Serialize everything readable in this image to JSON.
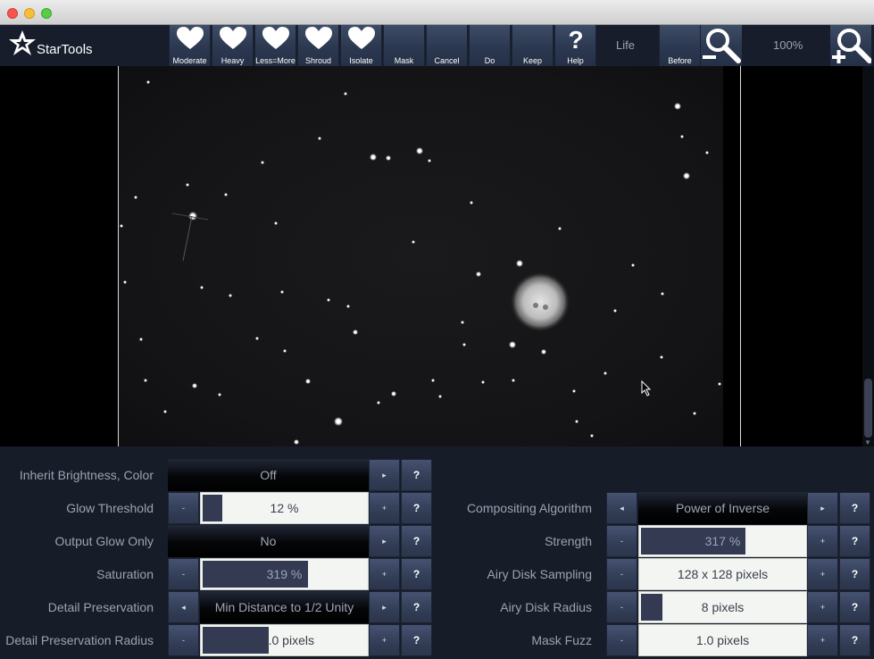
{
  "app": {
    "name": "StarTools"
  },
  "toolbar": {
    "buttons": [
      {
        "label": "Moderate",
        "icon": "heart-icon"
      },
      {
        "label": "Heavy",
        "icon": "heart-icon"
      },
      {
        "label": "Less=More",
        "icon": "heart-icon"
      },
      {
        "label": "Shroud",
        "icon": "heart-icon"
      },
      {
        "label": "Isolate",
        "icon": "heart-icon"
      },
      {
        "label": "Mask",
        "icon": ""
      },
      {
        "label": "Cancel",
        "icon": ""
      },
      {
        "label": "Do",
        "icon": ""
      },
      {
        "label": "Keep",
        "icon": ""
      },
      {
        "label": "Help",
        "icon": "question-icon"
      }
    ],
    "module": "Life",
    "before_label": "Before",
    "zoom": "100%"
  },
  "params_left": [
    {
      "label": "Inherit Brightness, Color",
      "value": "Off",
      "type": "toggle"
    },
    {
      "label": "Glow Threshold",
      "value": "12 %",
      "type": "slider",
      "fill": 0.12
    },
    {
      "label": "Output Glow Only",
      "value": "No",
      "type": "toggle"
    },
    {
      "label": "Saturation",
      "value": "319 %",
      "type": "slider",
      "fill": 0.64
    },
    {
      "label": "Detail Preservation",
      "value": "Min Distance to 1/2 Unity",
      "type": "select"
    },
    {
      "label": "Detail Preservation Radius",
      "value": "20.0 pixels",
      "type": "slider",
      "fill": 0.4
    }
  ],
  "params_right": [
    {
      "label": "Compositing Algorithm",
      "value": "Power of Inverse",
      "type": "select"
    },
    {
      "label": "Strength",
      "value": "317 %",
      "type": "slider",
      "fill": 0.63
    },
    {
      "label": "Airy Disk Sampling",
      "value": "128 x 128 pixels",
      "type": "slider",
      "fill": 0
    },
    {
      "label": "Airy Disk Radius",
      "value": "8 pixels",
      "type": "slider",
      "fill": 0.13
    },
    {
      "label": "Mask Fuzz",
      "value": "1.0 pixels",
      "type": "slider",
      "fill": 0
    }
  ],
  "common": {
    "minus": "-",
    "plus": "+",
    "help": "?",
    "left_arrow": "◂",
    "right_arrow": "▸"
  },
  "colors": {
    "toolbar": "#171d2b",
    "panel": "#161c28",
    "slider_fill": "#333a52",
    "field": "#f2f5f2"
  }
}
